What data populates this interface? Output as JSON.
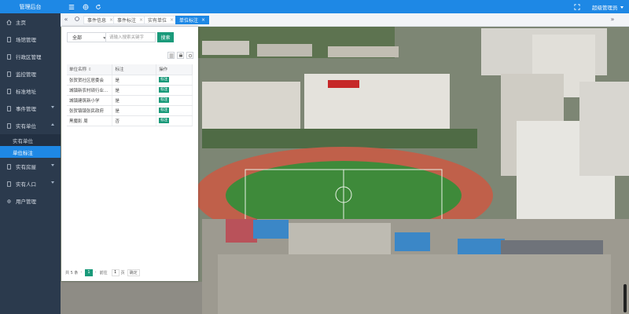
{
  "app": {
    "title": "管理后台"
  },
  "sidebar": {
    "items": [
      {
        "label": "主页",
        "icon": "home-icon"
      },
      {
        "label": "场馆管理",
        "icon": "file-icon"
      },
      {
        "label": "行政区管理",
        "icon": "file-icon"
      },
      {
        "label": "监控管理",
        "icon": "file-icon"
      },
      {
        "label": "标准地址",
        "icon": "file-icon"
      },
      {
        "label": "事件管理",
        "icon": "file-icon",
        "caret": true
      },
      {
        "label": "实有单位",
        "icon": "file-icon",
        "caret": true,
        "open": true
      },
      {
        "label": "实有房屋",
        "icon": "file-icon",
        "caret": true
      },
      {
        "label": "实有人口",
        "icon": "file-icon",
        "caret": true
      },
      {
        "label": "用户管理",
        "icon": "gear-icon"
      }
    ],
    "submenu": [
      {
        "label": "实有单位",
        "active": false
      },
      {
        "label": "单位标注",
        "active": true
      }
    ]
  },
  "topbar": {
    "user": "超级管理员"
  },
  "tabs": [
    {
      "label": "事件信息",
      "active": false
    },
    {
      "label": "事件标注",
      "active": false
    },
    {
      "label": "实有单位",
      "active": false
    },
    {
      "label": "单位标注",
      "active": true
    }
  ],
  "panel": {
    "filter_value": "全部",
    "search_placeholder": "请输入搜索关键字",
    "search_label": "搜索",
    "columns": [
      "单位名称",
      "标注",
      "操作"
    ],
    "rows": [
      {
        "name": "张贺贺社区居委会",
        "mark": "是",
        "action": "标注",
        "mark_red": false
      },
      {
        "name": "城镇新农村硕行业...",
        "mark": "是",
        "action": "标注",
        "mark_red": false
      },
      {
        "name": "城镇建筑新小学",
        "mark": "是",
        "action": "标注",
        "mark_red": false
      },
      {
        "name": "张贺镇镇张民政府",
        "mark": "是",
        "action": "标注",
        "mark_red": false
      },
      {
        "name": "黑魔影 周",
        "mark": "否",
        "action": "标注",
        "mark_red": true
      }
    ],
    "pager": {
      "total": "共 5 条",
      "current_page": "1",
      "goto_prefix": "前往",
      "goto_value": "1",
      "goto_suffix": "页",
      "confirm": "确定"
    }
  },
  "colors": {
    "sidebar_bg": "#2b3a4d",
    "topbar_bg": "#1e88e5",
    "accent_green": "#1a9a7a"
  }
}
